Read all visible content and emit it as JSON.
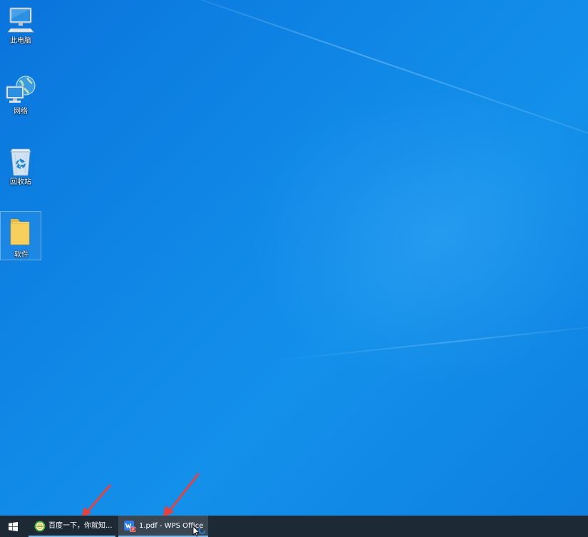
{
  "desktop": {
    "icons": [
      {
        "label": "此电脑",
        "icon": "this-pc-icon"
      },
      {
        "label": "网络",
        "icon": "network-icon"
      },
      {
        "label": "回收站",
        "icon": "recycle-bin-icon"
      },
      {
        "label": "软件",
        "icon": "folder-icon"
      }
    ],
    "wallpaper_color": "#0f86e6"
  },
  "taskbar": {
    "start_icon": "windows-logo-icon",
    "buttons": [
      {
        "label": "百度一下，你就知...",
        "icon": "browser-360-icon"
      },
      {
        "label": "1.pdf - WPS Office",
        "icon": "wps-office-icon"
      }
    ],
    "background": "#1d2a35"
  },
  "annotations": {
    "arrow_color": "#e8403b"
  }
}
